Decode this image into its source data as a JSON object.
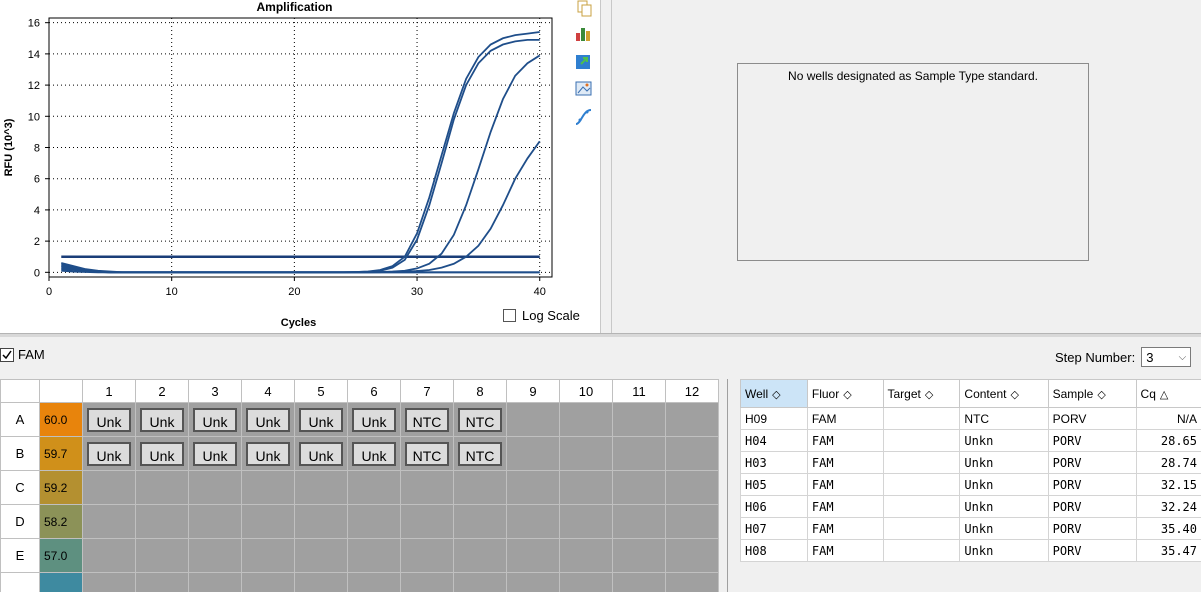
{
  "chart": {
    "icons": [
      "copy-icon",
      "bar-chart-icon",
      "export-icon",
      "image-icon",
      "curve-icon"
    ],
    "log_scale_label": "Log Scale"
  },
  "chart_data": {
    "type": "line",
    "title": "Amplification",
    "xlabel": "Cycles",
    "ylabel": "RFU (10^3)",
    "xlim": [
      0,
      41
    ],
    "ylim": [
      -0.3,
      16.3
    ],
    "xticks": [
      0,
      10,
      20,
      30,
      40
    ],
    "yticks": [
      0,
      2,
      4,
      6,
      8,
      10,
      12,
      14,
      16
    ],
    "grid": true,
    "threshold": 1.0,
    "x": [
      1,
      2,
      3,
      4,
      5,
      6,
      7,
      8,
      9,
      10,
      11,
      12,
      13,
      14,
      15,
      16,
      17,
      18,
      19,
      20,
      21,
      22,
      23,
      24,
      25,
      26,
      27,
      28,
      29,
      30,
      31,
      32,
      33,
      34,
      35,
      36,
      37,
      38,
      39,
      40
    ],
    "series": [
      {
        "values": [
          0.5,
          0.3,
          0.15,
          0.05,
          0,
          0,
          0,
          0,
          0,
          0,
          0,
          0,
          0,
          0,
          0,
          0,
          0,
          0,
          0,
          0,
          0,
          0,
          0,
          0,
          0.02,
          0.05,
          0.15,
          0.4,
          1.0,
          2.5,
          4.8,
          7.5,
          10.2,
          12.4,
          13.8,
          14.6,
          15.0,
          15.2,
          15.3,
          15.4
        ]
      },
      {
        "values": [
          0.4,
          0.25,
          0.12,
          0.04,
          0,
          0,
          0,
          0,
          0,
          0,
          0,
          0,
          0,
          0,
          0,
          0,
          0,
          0,
          0,
          0,
          0,
          0,
          0,
          0,
          0.02,
          0.04,
          0.1,
          0.3,
          0.8,
          2.1,
          4.3,
          7.0,
          9.8,
          12.0,
          13.4,
          14.2,
          14.6,
          14.8,
          14.9,
          14.9
        ]
      },
      {
        "values": [
          0.3,
          0.2,
          0.1,
          0.03,
          0,
          0,
          0,
          0,
          0,
          0,
          0,
          0,
          0,
          0,
          0,
          0,
          0,
          0,
          0,
          0,
          0,
          0,
          0,
          0,
          0,
          0.01,
          0.02,
          0.05,
          0.1,
          0.25,
          0.55,
          1.2,
          2.4,
          4.3,
          6.6,
          9.0,
          11.1,
          12.6,
          13.4,
          13.9
        ]
      },
      {
        "values": [
          0.2,
          0.15,
          0.08,
          0.02,
          0,
          0,
          0,
          0,
          0,
          0,
          0,
          0,
          0,
          0,
          0,
          0,
          0,
          0,
          0,
          0,
          0,
          0,
          0,
          0,
          0,
          0,
          0.01,
          0.02,
          0.04,
          0.08,
          0.15,
          0.3,
          0.55,
          1.0,
          1.7,
          2.8,
          4.3,
          6.0,
          7.3,
          8.4
        ]
      },
      {
        "values": [
          0.6,
          0.4,
          0.2,
          0.1,
          0.05,
          0,
          0,
          0,
          0,
          0,
          0,
          0,
          0,
          0,
          0,
          0,
          0,
          0,
          0,
          0,
          0,
          0,
          0,
          0,
          0,
          0,
          0,
          0,
          0,
          0,
          0,
          0,
          0,
          0,
          0,
          0,
          0,
          0,
          0,
          0
        ]
      },
      {
        "values": [
          0.1,
          0.05,
          0.02,
          0,
          0,
          0,
          0,
          0,
          0,
          0,
          0,
          0,
          0,
          0,
          0,
          0,
          0,
          0,
          0,
          0,
          0,
          0,
          0,
          0,
          0,
          0,
          0,
          0,
          0,
          0,
          0,
          0,
          0,
          0,
          0,
          0,
          0,
          0,
          0,
          0
        ]
      }
    ]
  },
  "standard_message": "No wells designated as Sample Type standard.",
  "fluor": {
    "label": "FAM",
    "checked": true
  },
  "step": {
    "label": "Step Number:",
    "value": "3"
  },
  "plate": {
    "columns": [
      "1",
      "2",
      "3",
      "4",
      "5",
      "6",
      "7",
      "8",
      "9",
      "10",
      "11",
      "12"
    ],
    "rows": [
      {
        "label": "A",
        "temp": "60.0",
        "temp_color": "#e8840c",
        "wells": [
          "Unk",
          "Unk",
          "Unk",
          "Unk",
          "Unk",
          "Unk",
          "NTC",
          "NTC",
          "",
          "",
          "",
          ""
        ]
      },
      {
        "label": "B",
        "temp": "59.7",
        "temp_color": "#d0901a",
        "wells": [
          "Unk",
          "Unk",
          "Unk",
          "Unk",
          "Unk",
          "Unk",
          "NTC",
          "NTC",
          "",
          "",
          "",
          ""
        ]
      },
      {
        "label": "C",
        "temp": "59.2",
        "temp_color": "#b49030",
        "wells": [
          "",
          "",
          "",
          "",
          "",
          "",
          "",
          "",
          "",
          "",
          "",
          ""
        ]
      },
      {
        "label": "D",
        "temp": "58.2",
        "temp_color": "#8c9258",
        "wells": [
          "",
          "",
          "",
          "",
          "",
          "",
          "",
          "",
          "",
          "",
          "",
          ""
        ]
      },
      {
        "label": "E",
        "temp": "57.0",
        "temp_color": "#5e9080",
        "wells": [
          "",
          "",
          "",
          "",
          "",
          "",
          "",
          "",
          "",
          "",
          "",
          ""
        ]
      },
      {
        "label": "",
        "temp": "",
        "temp_color": "#3e8aa0",
        "wells": [
          "",
          "",
          "",
          "",
          "",
          "",
          "",
          "",
          "",
          "",
          "",
          ""
        ]
      }
    ]
  },
  "results": {
    "headers": [
      "Well",
      "Fluor",
      "Target",
      "Content",
      "Sample",
      "Cq"
    ],
    "rows": [
      [
        "H09",
        "FAM",
        "",
        "NTC",
        "PORV",
        "N/A"
      ],
      [
        "H04",
        "FAM",
        "",
        "Unkn",
        "PORV",
        "28.65"
      ],
      [
        "H03",
        "FAM",
        "",
        "Unkn",
        "PORV",
        "28.74"
      ],
      [
        "H05",
        "FAM",
        "",
        "Unkn",
        "PORV",
        "32.15"
      ],
      [
        "H06",
        "FAM",
        "",
        "Unkn",
        "PORV",
        "32.24"
      ],
      [
        "H07",
        "FAM",
        "",
        "Unkn",
        "PORV",
        "35.40"
      ],
      [
        "H08",
        "FAM",
        "",
        "Unkn",
        "PORV",
        "35.47"
      ]
    ]
  }
}
